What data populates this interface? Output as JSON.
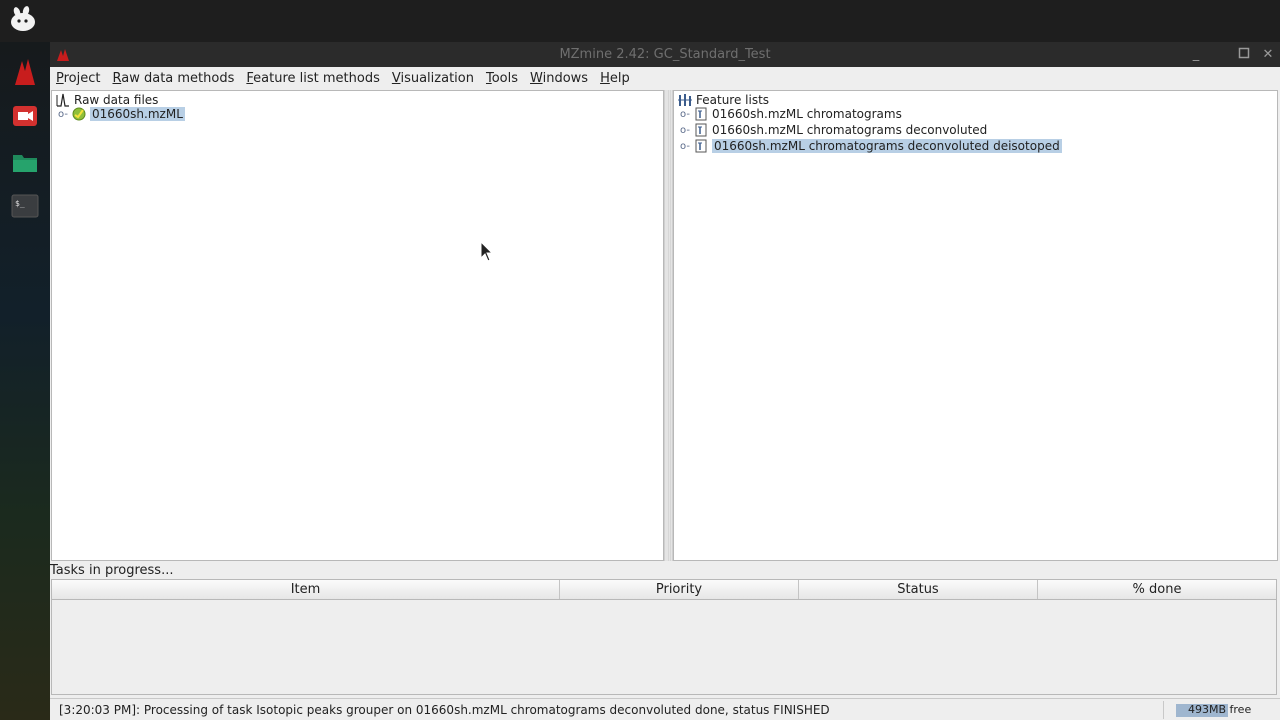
{
  "window": {
    "title": "MZmine 2.42: GC_Standard_Test"
  },
  "menu": [
    {
      "first": "P",
      "rest": "roject"
    },
    {
      "first": "R",
      "rest": "aw data methods"
    },
    {
      "first": "F",
      "rest": "eature list methods"
    },
    {
      "first": "V",
      "rest": "isualization"
    },
    {
      "first": "T",
      "rest": "ools"
    },
    {
      "first": "W",
      "rest": "indows"
    },
    {
      "first": "H",
      "rest": "elp"
    }
  ],
  "raw_data": {
    "root_label": "Raw data files",
    "files": [
      "01660sh.mzML"
    ]
  },
  "feature_lists": {
    "root_label": "Feature lists",
    "items": [
      "01660sh.mzML chromatograms",
      "01660sh.mzML chromatograms deconvoluted",
      "01660sh.mzML chromatograms deconvoluted deisotoped"
    ]
  },
  "tasks": {
    "label": "Tasks in progress...",
    "columns": [
      "Item",
      "Priority",
      "Status",
      "% done"
    ]
  },
  "status": {
    "message": "[3:20:03 PM]: Processing of task Isotopic peaks grouper on 01660sh.mzML chromatograms deconvoluted done, status FINISHED",
    "memory": "493MB free",
    "memory_used_fraction": 0.45
  },
  "colors": {
    "selection": "#b8cfe5",
    "memory_bar": "#9fb6cf"
  }
}
